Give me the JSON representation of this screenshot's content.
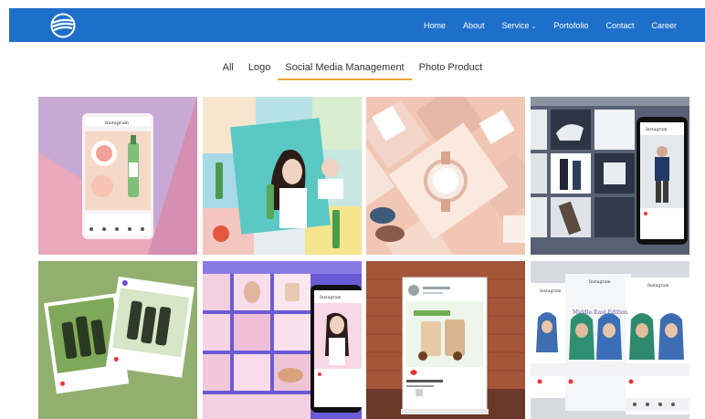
{
  "nav": {
    "items": [
      {
        "label": "Home"
      },
      {
        "label": "About"
      },
      {
        "label": "Service",
        "has_dropdown": true
      },
      {
        "label": "Portofolio"
      },
      {
        "label": "Contact"
      },
      {
        "label": "Career"
      }
    ],
    "chevron": "⌄",
    "background": "#1e6fc9"
  },
  "filters": {
    "items": [
      "All",
      "Logo",
      "Social Media Management",
      "Photo Product"
    ],
    "active": "Social Media Management",
    "accent": "#f0a53a"
  },
  "portfolio": {
    "tiles": [
      {
        "name": "soju-instagram-mockup"
      },
      {
        "name": "soju-collage"
      },
      {
        "name": "watch-tablet-flatlay"
      },
      {
        "name": "fashion-instagram-feed"
      },
      {
        "name": "green-bottle-posts"
      },
      {
        "name": "purple-beauty-feed"
      },
      {
        "name": "bubble-tea-easel"
      },
      {
        "name": "middle-east-edition-posts"
      }
    ],
    "tile_text": {
      "instagram": "Instagram",
      "middle_east": "Middle East Edition"
    }
  }
}
